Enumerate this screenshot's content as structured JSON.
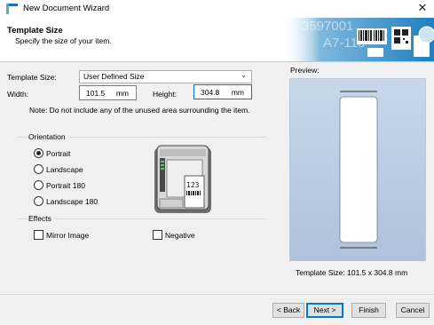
{
  "window": {
    "title": "New Document Wizard",
    "close_glyph": "✕"
  },
  "header": {
    "title": "Template Size",
    "subtitle": "Specify the size of your item.",
    "banner_text_1": "3597001",
    "banner_text_2": "A7-116"
  },
  "form": {
    "template_size_label": "Template Size:",
    "template_size_value": "User Defined Size",
    "width_label": "Width:",
    "width_value": "101.5",
    "width_unit": "mm",
    "height_label": "Height:",
    "height_value": "304.8",
    "height_unit": "mm",
    "note": "Note: Do not include any of the unused area surrounding the item."
  },
  "orientation": {
    "group_label": "Orientation",
    "options": [
      {
        "label": "Portrait",
        "checked": true
      },
      {
        "label": "Landscape",
        "checked": false
      },
      {
        "label": "Portrait 180",
        "checked": false
      },
      {
        "label": "Landscape 180",
        "checked": false
      }
    ],
    "printer_label_text": "123"
  },
  "effects": {
    "group_label": "Effects",
    "mirror_label": "Mirror Image",
    "negative_label": "Negative",
    "mirror_checked": false,
    "negative_checked": false
  },
  "preview": {
    "label": "Preview:",
    "template_size_text": "Template Size:  101.5 x 304.8 mm"
  },
  "buttons": {
    "back": "< Back",
    "next": "Next >",
    "finish": "Finish",
    "cancel": "Cancel"
  },
  "colors": {
    "accent": "#0078d7",
    "banner_blue": "#2f8fc7",
    "preview_bg": "#b9cbe2"
  }
}
